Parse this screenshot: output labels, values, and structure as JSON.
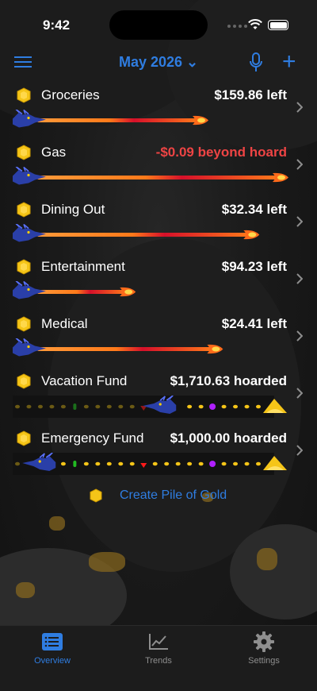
{
  "status_bar": {
    "time": "9:42"
  },
  "header": {
    "month_label": "May 2026 ⌄"
  },
  "budgets": [
    {
      "name": "Groceries",
      "amount": "$159.86 left",
      "kind": "left",
      "progress": 0.67
    },
    {
      "name": "Gas",
      "amount": "-$0.09 beyond hoard",
      "kind": "over",
      "progress": 1.0
    },
    {
      "name": "Dining Out",
      "amount": "$32.34 left",
      "kind": "left",
      "progress": 0.88
    },
    {
      "name": "Entertainment",
      "amount": "$94.23 left",
      "kind": "left",
      "progress": 0.37
    },
    {
      "name": "Medical",
      "amount": "$24.41 left",
      "kind": "left",
      "progress": 0.73
    },
    {
      "name": "Vacation Fund",
      "amount": "$1,710.63 hoarded",
      "kind": "hoard",
      "progress": 0.56
    },
    {
      "name": "Emergency Fund",
      "amount": "$1,000.00 hoarded",
      "kind": "hoard",
      "progress": 0.06
    }
  ],
  "create_button": {
    "label": "Create Pile of Gold"
  },
  "tabs": [
    {
      "label": "Overview",
      "icon": "list-icon",
      "active": true
    },
    {
      "label": "Trends",
      "icon": "chart-icon",
      "active": false
    },
    {
      "label": "Settings",
      "icon": "gear-icon",
      "active": false
    }
  ],
  "colors": {
    "accent": "#2f7de1",
    "negative": "#ee4444",
    "flame": "#ff6a1a",
    "gold": "#f5c518",
    "dragon": "#2a3fa8"
  }
}
